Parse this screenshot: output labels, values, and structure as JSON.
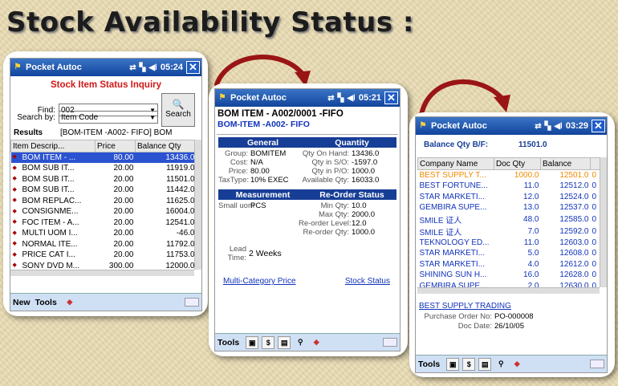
{
  "headline": "Stock Availability Status :",
  "colors": {
    "titlebar": "#1a4fa8",
    "selected_row": "#2b53d0",
    "highlight": "#f08a00",
    "heading_red": "#d01818",
    "link": "#1133bb",
    "arrow": "#9a1515"
  },
  "phone1": {
    "title": "Pocket Autoc",
    "time": "05:24",
    "close": "✕",
    "heading": "Stock Item Status Inquiry",
    "find_label": "Find:",
    "find_value": "002",
    "searchby_label": "Search by:",
    "searchby_value": "Item Code",
    "search_button": "Search",
    "results_label": "Results",
    "results_value": "[BOM-ITEM -A002- FIFO] BOM",
    "columns": [
      "Item Descrip...",
      "Price",
      "Balance Qty"
    ],
    "rows": [
      [
        "BOM  ITEM - ...",
        "80.00",
        "13436.0"
      ],
      [
        "BOM  SUB IT...",
        "20.00",
        "11919.0"
      ],
      [
        "BOM  SUB IT...",
        "20.00",
        "11501.0"
      ],
      [
        "BOM  SUB IT...",
        "20.00",
        "11442.0"
      ],
      [
        "BOM REPLAC...",
        "20.00",
        "11625.0"
      ],
      [
        "CONSIGNME...",
        "20.00",
        "16004.0"
      ],
      [
        "FOC ITEM - A...",
        "20.00",
        "12541.0"
      ],
      [
        "MULTI UOM I...",
        "20.00",
        "-46.0"
      ],
      [
        "NORMAL ITE...",
        "20.00",
        "11792.0"
      ],
      [
        "PRICE CAT I...",
        "20.00",
        "11753.0"
      ],
      [
        "SONY DVD M...",
        "300.00",
        "12000.0"
      ]
    ],
    "bottom_new": "New",
    "bottom_tools": "Tools"
  },
  "phone2": {
    "title": "Pocket Autoc",
    "time": "05:21",
    "close": "✕",
    "item_title": "BOM ITEM - A002/0001 -FIFO",
    "item_sub": "BOM-ITEM -A002- FIFO",
    "general_header": "General",
    "quantity_header": "Quantity",
    "general": [
      [
        "Group:",
        "BOMITEM"
      ],
      [
        "Cost:",
        "N/A"
      ],
      [
        "Price:",
        "80.00"
      ],
      [
        "TaxType:",
        "10% EXEC"
      ]
    ],
    "quantity": [
      [
        "Qty On Hand:",
        "13436.0"
      ],
      [
        "Qty in S/O:",
        "-1597.0"
      ],
      [
        "Qty in P/O:",
        "1000.0"
      ],
      [
        "Available Qty:",
        "16033.0"
      ]
    ],
    "measurement_header": "Measurement",
    "reorder_header": "Re-Order Status",
    "small_uom_label": "Small uom",
    "small_uom_value": "PCS",
    "reorder": [
      [
        "Min Qty:",
        "10.0"
      ],
      [
        "Max Qty:",
        "2000.0"
      ],
      [
        "Re-order Level:",
        "12.0"
      ],
      [
        "Re-order Qty:",
        "1000.0"
      ]
    ],
    "lead_label": "Lead Time:",
    "lead_value": "2 Weeks",
    "link_price": "Multi-Category Price",
    "link_stock": "Stock Status",
    "bottom_tools": "Tools"
  },
  "phone3": {
    "title": "Pocket Autoc",
    "time": "03:29",
    "close": "✕",
    "bf_label": "Balance Qty B/F:",
    "bf_value": "11501.0",
    "columns": [
      "Company Name",
      "Doc Qty",
      "Balance"
    ],
    "rows": [
      [
        "BEST SUPPLY T...",
        "1000.0",
        "12501.0"
      ],
      [
        "BEST FORTUNE...",
        "11.0",
        "12512.0"
      ],
      [
        "STAR MARKETI...",
        "12.0",
        "12524.0"
      ],
      [
        "GEMBIRA SUPE...",
        "13.0",
        "12537.0"
      ],
      [
        "SMILE 证人",
        "48.0",
        "12585.0"
      ],
      [
        "SMILE 证人",
        "7.0",
        "12592.0"
      ],
      [
        "TEKNOLOGY ED...",
        "11.0",
        "12603.0"
      ],
      [
        "STAR MARKETI...",
        "5.0",
        "12608.0"
      ],
      [
        "STAR MARKETI...",
        "4.0",
        "12612.0"
      ],
      [
        "SHINING SUN H...",
        "16.0",
        "12628.0"
      ],
      [
        "GEMBIRA SUPE...",
        "2.0",
        "12630.0"
      ]
    ],
    "extra_col": "0",
    "detail_company": "BEST SUPPLY TRADING",
    "detail_po_label": "Purchase Order No:",
    "detail_po_value": "PO-000008",
    "detail_date_label": "Doc Date:",
    "detail_date_value": "26/10/05",
    "bottom_tools": "Tools"
  }
}
